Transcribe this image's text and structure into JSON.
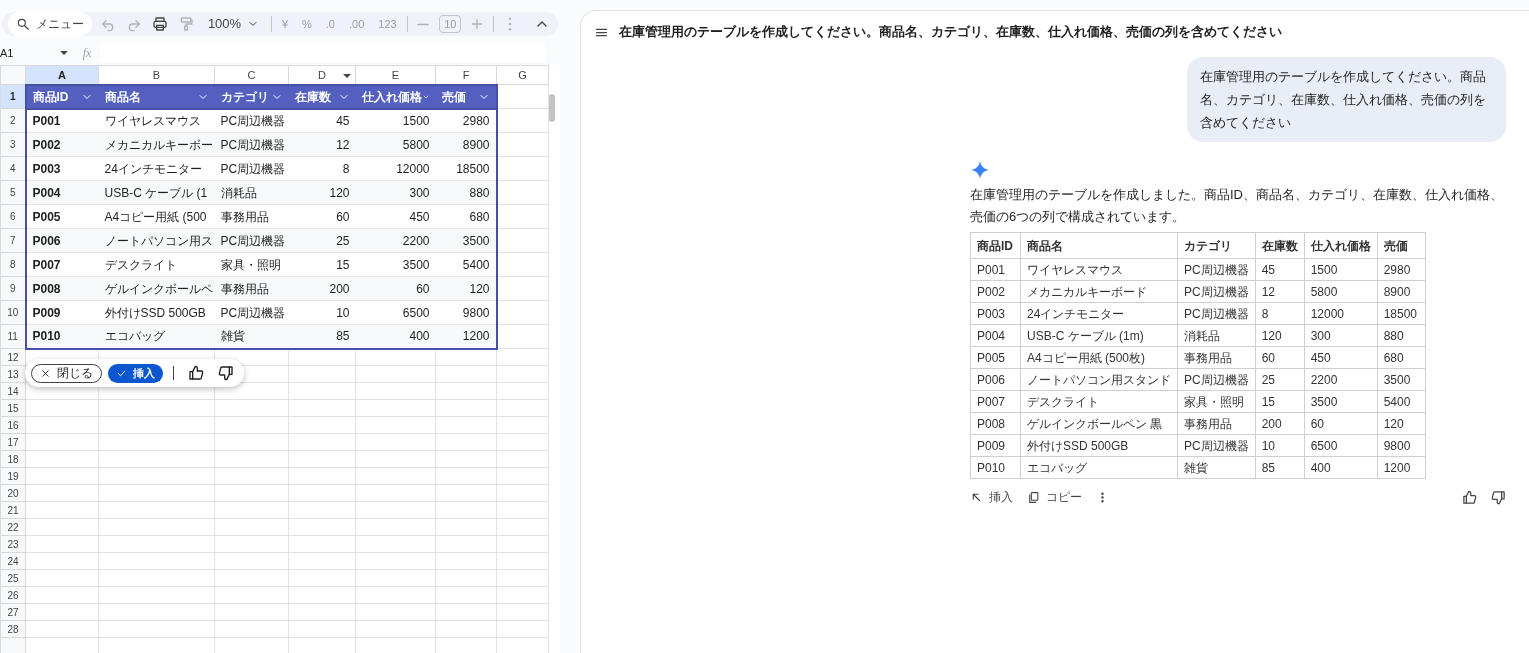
{
  "sheet": {
    "toolbar": {
      "search_label": "メニュー",
      "zoom": "100%",
      "format_buttons": [
        {
          "label": "¥",
          "disabled": true
        },
        {
          "label": "%",
          "disabled": true
        },
        {
          "label": ".0",
          "disabled": true
        },
        {
          "label": ".00",
          "disabled": true
        },
        {
          "label": "123",
          "disabled": true
        }
      ],
      "font_size": "10"
    },
    "name_box": "A1",
    "formula_label": "fx",
    "column_letters": [
      {
        "label": "A",
        "selected": true
      },
      {
        "label": "B",
        "selected": false
      },
      {
        "label": "C",
        "selected": false
      },
      {
        "label": "D",
        "selected": false
      },
      {
        "label": "E",
        "selected": false
      },
      {
        "label": "F",
        "selected": false
      },
      {
        "label": "G",
        "selected": false
      }
    ],
    "header": [
      "商品ID",
      "商品名",
      "カテゴリ",
      "在庫数",
      "仕入れ価格",
      "売価"
    ],
    "rows": [
      [
        "P001",
        "ワイヤレスマウス",
        "PC周辺機器",
        "45",
        "1500",
        "2980"
      ],
      [
        "P002",
        "メカニカルキーボー",
        "PC周辺機器",
        "12",
        "5800",
        "8900"
      ],
      [
        "P003",
        "24インチモニター",
        "PC周辺機器",
        "8",
        "12000",
        "18500"
      ],
      [
        "P004",
        "USB-C ケーブル (1",
        "消耗品",
        "120",
        "300",
        "880"
      ],
      [
        "P005",
        "A4コピー用紙 (500",
        "事務用品",
        "60",
        "450",
        "680"
      ],
      [
        "P006",
        "ノートパソコン用ス",
        "PC周辺機器",
        "25",
        "2200",
        "3500"
      ],
      [
        "P007",
        "デスクライト",
        "家具・照明",
        "15",
        "3500",
        "5400"
      ],
      [
        "P008",
        "ゲルインクボールペ",
        "事務用品",
        "200",
        "60",
        "120"
      ],
      [
        "P009",
        "外付けSSD 500GB",
        "PC周辺機器",
        "10",
        "6500",
        "9800"
      ],
      [
        "P010",
        "エコバッグ",
        "雑貨",
        "85",
        "400",
        "1200"
      ]
    ],
    "row_numbers": [
      {
        "label": "1",
        "selected": true
      },
      {
        "label": "2",
        "selected": false
      },
      {
        "label": "3",
        "selected": false
      },
      {
        "label": "4",
        "selected": false
      },
      {
        "label": "5",
        "selected": false
      },
      {
        "label": "6",
        "selected": false
      },
      {
        "label": "7",
        "selected": false
      },
      {
        "label": "8",
        "selected": false
      },
      {
        "label": "9",
        "selected": false
      },
      {
        "label": "10",
        "selected": false
      },
      {
        "label": "11",
        "selected": false
      },
      {
        "label": "12",
        "selected": false
      },
      {
        "label": "13",
        "selected": false
      },
      {
        "label": "14",
        "selected": false
      },
      {
        "label": "15",
        "selected": false
      },
      {
        "label": "16",
        "selected": false
      },
      {
        "label": "17",
        "selected": false
      },
      {
        "label": "18",
        "selected": false
      },
      {
        "label": "19",
        "selected": false
      },
      {
        "label": "20",
        "selected": false
      },
      {
        "label": "21",
        "selected": false
      },
      {
        "label": "22",
        "selected": false
      },
      {
        "label": "23",
        "selected": false
      },
      {
        "label": "24",
        "selected": false
      },
      {
        "label": "25",
        "selected": false
      },
      {
        "label": "26",
        "selected": false
      },
      {
        "label": "27",
        "selected": false
      },
      {
        "label": "28",
        "selected": false
      }
    ],
    "suggestion_bar": {
      "close": "閉じる",
      "insert": "挿入"
    }
  },
  "chat": {
    "title": "在庫管理用のテーブルを作成してください。商品名、カテゴリ、在庫数、仕入れ価格、売価の列を含めてください",
    "user_message": "在庫管理用のテーブルを作成してください。商品名、カテゴリ、在庫数、仕入れ価格、売価の列を含めてください",
    "response": "在庫管理用のテーブルを作成しました。商品ID、商品名、カテゴリ、在庫数、仕入れ価格、売価の6つの列で構成されています。",
    "table": {
      "columns": [
        "商品ID",
        "商品名",
        "カテゴリ",
        "在庫数",
        "仕入れ価格",
        "売価"
      ],
      "rows": [
        [
          "P001",
          "ワイヤレスマウス",
          "PC周辺機器",
          "45",
          "1500",
          "2980"
        ],
        [
          "P002",
          "メカニカルキーボード",
          "PC周辺機器",
          "12",
          "5800",
          "8900"
        ],
        [
          "P003",
          "24インチモニター",
          "PC周辺機器",
          "8",
          "12000",
          "18500"
        ],
        [
          "P004",
          "USB-C ケーブル (1m)",
          "消耗品",
          "120",
          "300",
          "880"
        ],
        [
          "P005",
          "A4コピー用紙 (500枚)",
          "事務用品",
          "60",
          "450",
          "680"
        ],
        [
          "P006",
          "ノートパソコン用スタンド",
          "PC周辺機器",
          "25",
          "2200",
          "3500"
        ],
        [
          "P007",
          "デスクライト",
          "家具・照明",
          "15",
          "3500",
          "5400"
        ],
        [
          "P008",
          "ゲルインクボールペン 黒",
          "事務用品",
          "200",
          "60",
          "120"
        ],
        [
          "P009",
          "外付けSSD 500GB",
          "PC周辺機器",
          "10",
          "6500",
          "9800"
        ],
        [
          "P010",
          "エコバッグ",
          "雑貨",
          "85",
          "400",
          "1200"
        ]
      ]
    },
    "actions": {
      "insert": "挿入",
      "copy": "コピー"
    }
  }
}
